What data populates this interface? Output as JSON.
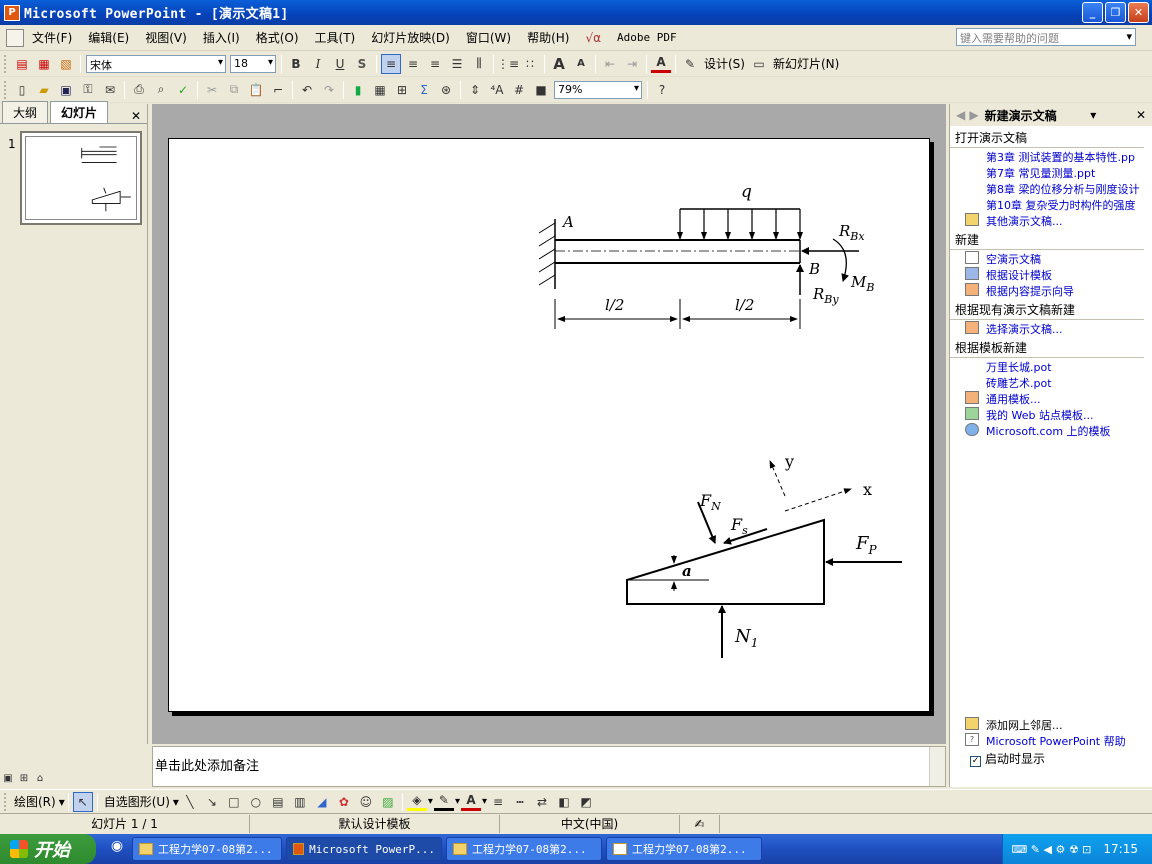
{
  "window": {
    "title": "Microsoft PowerPoint - [演示文稿1]",
    "minimize": "_",
    "restore": "❐",
    "close": "✕"
  },
  "menubar": {
    "items": [
      "文件(F)",
      "编辑(E)",
      "视图(V)",
      "插入(I)",
      "格式(O)",
      "工具(T)",
      "幻灯片放映(D)",
      "窗口(W)",
      "帮助(H)"
    ],
    "adobe": "Adobe PDF",
    "help_placeholder": "键入需要帮助的问题"
  },
  "format_toolbar": {
    "font": "宋体",
    "size": "18",
    "bold": "B",
    "italic": "I",
    "underline": "U",
    "shadow": "S",
    "design": "设计(S)",
    "new_slide": "新幻灯片(N)"
  },
  "standard_toolbar": {
    "zoom": "79%"
  },
  "left_pane": {
    "tabs": [
      "大纲",
      "幻灯片"
    ],
    "close": "✕",
    "slide_number": "1"
  },
  "slide": {
    "beam": {
      "q": "q",
      "A": "A",
      "B": "B",
      "RBx": "R",
      "RBx_sub": "Bx",
      "RBy": "R",
      "RBy_sub": "By",
      "MB": "M",
      "MB_sub": "B",
      "half1": "l/2",
      "half2": "l/2"
    },
    "wedge": {
      "y": "y",
      "x": "x",
      "FN": "F",
      "FN_sub": "N",
      "Fs": "F",
      "Fs_sub": "s",
      "FP": "F",
      "FP_sub": "P",
      "a": "a",
      "N1": "N",
      "N1_sub": "1"
    }
  },
  "notes": {
    "placeholder": "单击此处添加备注"
  },
  "task_pane": {
    "title": "新建演示文稿",
    "sections": [
      {
        "heading": "打开演示文稿",
        "links": [
          "第3章 测试装置的基本特性.pp",
          "第7章 常见量测量.ppt",
          "第8章 梁的位移分析与刚度设计",
          "第10章 复杂受力时构件的强度",
          "其他演示文稿..."
        ]
      },
      {
        "heading": "新建",
        "links": [
          "空演示文稿",
          "根据设计模板",
          "根据内容提示向导"
        ]
      },
      {
        "heading": "根据现有演示文稿新建",
        "links": [
          "选择演示文稿..."
        ]
      },
      {
        "heading": "根据模板新建",
        "links": [
          "万里长城.pot",
          "砖雕艺术.pot",
          "通用模板...",
          "我的 Web 站点模板...",
          "Microsoft.com 上的模板"
        ]
      }
    ],
    "bottom": {
      "add_network": "添加网上邻居...",
      "help": "Microsoft PowerPoint 帮助",
      "show_at_startup": "启动时显示"
    }
  },
  "draw_toolbar": {
    "draw": "绘图(R)",
    "autoshapes": "自选图形(U)"
  },
  "statusbar": {
    "slide": "幻灯片 1 / 1",
    "design": "默认设计模板",
    "language": "中文(中国)"
  },
  "taskbar": {
    "start": "开始",
    "buttons": [
      "工程力学07-08第2...",
      "Microsoft PowerP...",
      "工程力学07-08第2...",
      "工程力学07-08第2..."
    ],
    "clock": "17:15"
  }
}
